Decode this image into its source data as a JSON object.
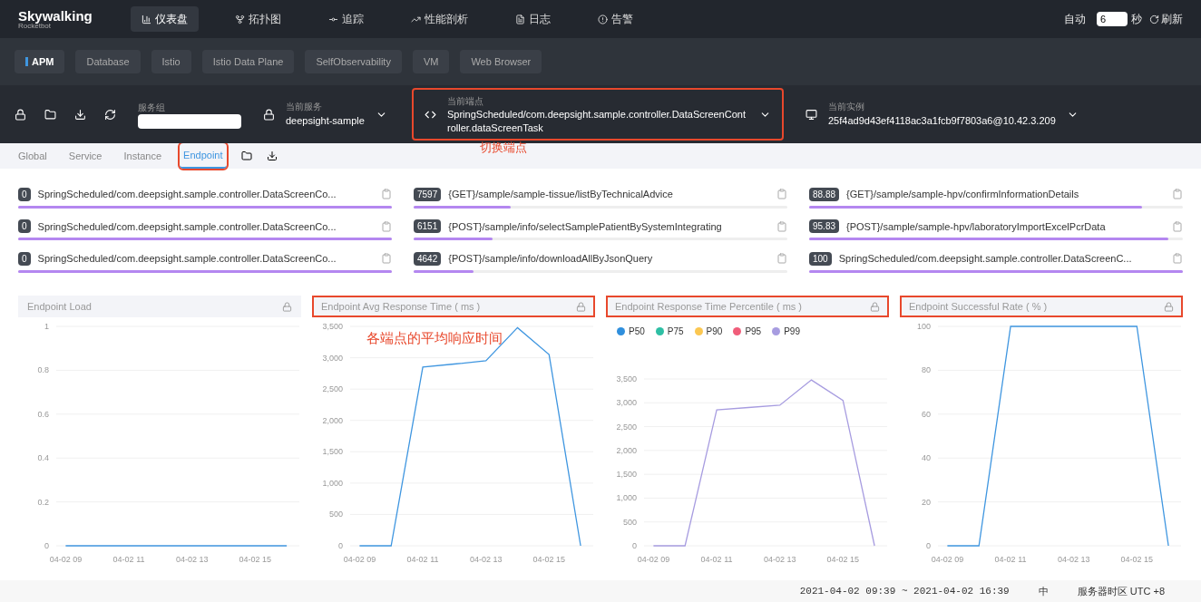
{
  "header": {
    "logo": "Skywalking",
    "logo_sub": "Rocketbot",
    "nav": [
      {
        "label": "仪表盘",
        "selected": true
      },
      {
        "label": "拓扑图",
        "selected": false
      },
      {
        "label": "追踪",
        "selected": false
      },
      {
        "label": "性能剖析",
        "selected": false
      },
      {
        "label": "日志",
        "selected": false
      },
      {
        "label": "告警",
        "selected": false
      }
    ],
    "auto_label": "自动",
    "interval": "6",
    "unit": "秒",
    "refresh": "刷新"
  },
  "groups": [
    {
      "label": "APM",
      "selected": true
    },
    {
      "label": "Database",
      "selected": false
    },
    {
      "label": "Istio",
      "selected": false
    },
    {
      "label": "Istio Data Plane",
      "selected": false
    },
    {
      "label": "SelfObservability",
      "selected": false
    },
    {
      "label": "VM",
      "selected": false
    },
    {
      "label": "Web Browser",
      "selected": false
    }
  ],
  "selectors": {
    "group_label": "服务组",
    "service_label": "当前服务",
    "service": "deepsight-sample",
    "endpoint_label": "当前端点",
    "endpoint": "SpringScheduled/com.deepsight.sample.controller.DataScreenController.dataScreenTask",
    "endpoint_highlighted": true,
    "endpoint_annotation": "切换端点",
    "instance_label": "当前实例",
    "instance": "25f4ad9d43ef4118ac3a1fcb9f7803a6@10.42.3.209"
  },
  "page_tabs": [
    {
      "label": "Global",
      "selected": false,
      "highlighted": false
    },
    {
      "label": "Service",
      "selected": false,
      "highlighted": false
    },
    {
      "label": "Instance",
      "selected": false,
      "highlighted": false
    },
    {
      "label": "Endpoint",
      "selected": true,
      "highlighted": true
    }
  ],
  "endpoint_lists": [
    [
      {
        "value": "0",
        "name": "SpringScheduled/com.deepsight.sample.controller.DataScreenCo...",
        "level": 1
      },
      {
        "value": "0",
        "name": "SpringScheduled/com.deepsight.sample.controller.DataScreenCo...",
        "level": 1
      },
      {
        "value": "0",
        "name": "SpringScheduled/com.deepsight.sample.controller.DataScreenCo...",
        "level": 1
      }
    ],
    [
      {
        "value": "7597",
        "name": "{GET}/sample/sample-tissue/listByTechnicalAdvice",
        "level": 0.26
      },
      {
        "value": "6151",
        "name": "{POST}/sample/info/selectSamplePatientBySystemIntegrating",
        "level": 0.21
      },
      {
        "value": "4642",
        "name": "{POST}/sample/info/downloadAllByJsonQuery",
        "level": 0.16
      }
    ],
    [
      {
        "value": "88.88",
        "name": "{GET}/sample/sample-hpv/confirmInformationDetails",
        "level": 0.89
      },
      {
        "value": "95.83",
        "name": "{POST}/sample/sample-hpv/laboratoryImportExcelPcrData",
        "level": 0.96
      },
      {
        "value": "100",
        "name": "SpringScheduled/com.deepsight.sample.controller.DataScreenC...",
        "level": 1
      }
    ]
  ],
  "charts": [
    {
      "title": "Endpoint Load",
      "highlighted": false,
      "chart_data": {
        "type": "line",
        "categories": [
          "04-02 09",
          null,
          "04-02 11",
          null,
          "04-02 13",
          null,
          "04-02 15",
          null
        ],
        "series": [
          {
            "color": "#3f96e0",
            "values": [
              0,
              0,
              0,
              0,
              0,
              0,
              0,
              0
            ]
          }
        ],
        "grid": true,
        "ylim": [
          0,
          1
        ],
        "yticks": [
          0,
          0.2,
          0.4,
          0.6,
          0.8,
          1
        ]
      }
    },
    {
      "title": "Endpoint Avg Response Time ( ms )",
      "highlighted": true,
      "annotation": "各端点的平均响应时间",
      "chart_data": {
        "type": "line",
        "categories": [
          "04-02 09",
          null,
          "04-02 11",
          null,
          "04-02 13",
          null,
          "04-02 15",
          null
        ],
        "series": [
          {
            "color": "#3f96e0",
            "values": [
              0,
              0,
              2850,
              2900,
              2950,
              3480,
              3050,
              0
            ]
          }
        ],
        "grid": true,
        "ylim": [
          0,
          3500
        ],
        "yticks": [
          0,
          {
            "value": 500,
            "label": "500"
          },
          {
            "value": 1000,
            "label": "1,000"
          },
          {
            "value": 1500,
            "label": "1,500"
          },
          {
            "value": 2000,
            "label": "2,000"
          },
          {
            "value": 2500,
            "label": "2,500"
          },
          {
            "value": 3000,
            "label": "3,000"
          },
          {
            "value": 3500,
            "label": "3,500"
          }
        ]
      }
    },
    {
      "title": "Endpoint Response Time Percentile ( ms )",
      "highlighted": true,
      "legend": [
        {
          "label": "P50",
          "color": "#2f8fdd"
        },
        {
          "label": "P75",
          "color": "#2ebfa4"
        },
        {
          "label": "P90",
          "color": "#fbc751"
        },
        {
          "label": "P95",
          "color": "#f05d7a"
        },
        {
          "label": "P99",
          "color": "#a79ce0"
        }
      ],
      "chart_data": {
        "type": "line",
        "categories": [
          "04-02 09",
          null,
          "04-02 11",
          null,
          "04-02 13",
          null,
          "04-02 15",
          null
        ],
        "series": [
          {
            "color": "#a79ce0",
            "values": [
              0,
              0,
              2850,
              2900,
              2950,
              3480,
              3050,
              0
            ]
          }
        ],
        "grid": true,
        "ylim": [
          0,
          3500
        ],
        "yticks": [
          0,
          {
            "value": 500,
            "label": "500"
          },
          {
            "value": 1000,
            "label": "1,000"
          },
          {
            "value": 1500,
            "label": "1,500"
          },
          {
            "value": 2000,
            "label": "2,000"
          },
          {
            "value": 2500,
            "label": "2,500"
          },
          {
            "value": 3000,
            "label": "3,000"
          },
          {
            "value": 3500,
            "label": "3,500"
          }
        ]
      }
    },
    {
      "title": "Endpoint Successful Rate ( % )",
      "highlighted": true,
      "chart_data": {
        "type": "line",
        "categories": [
          "04-02 09",
          null,
          "04-02 11",
          null,
          "04-02 13",
          null,
          "04-02 15",
          null
        ],
        "series": [
          {
            "color": "#3f96e0",
            "values": [
              0,
              0,
              100,
              100,
              100,
              100,
              100,
              0
            ]
          }
        ],
        "grid": true,
        "ylim": [
          0,
          100
        ],
        "yticks": [
          0,
          20,
          40,
          60,
          80,
          100
        ]
      }
    }
  ],
  "footer": {
    "time_range": "2021-04-02 09:39 ~ 2021-04-02 16:39",
    "language": "中",
    "timezone": "服务器时区 UTC +8"
  }
}
